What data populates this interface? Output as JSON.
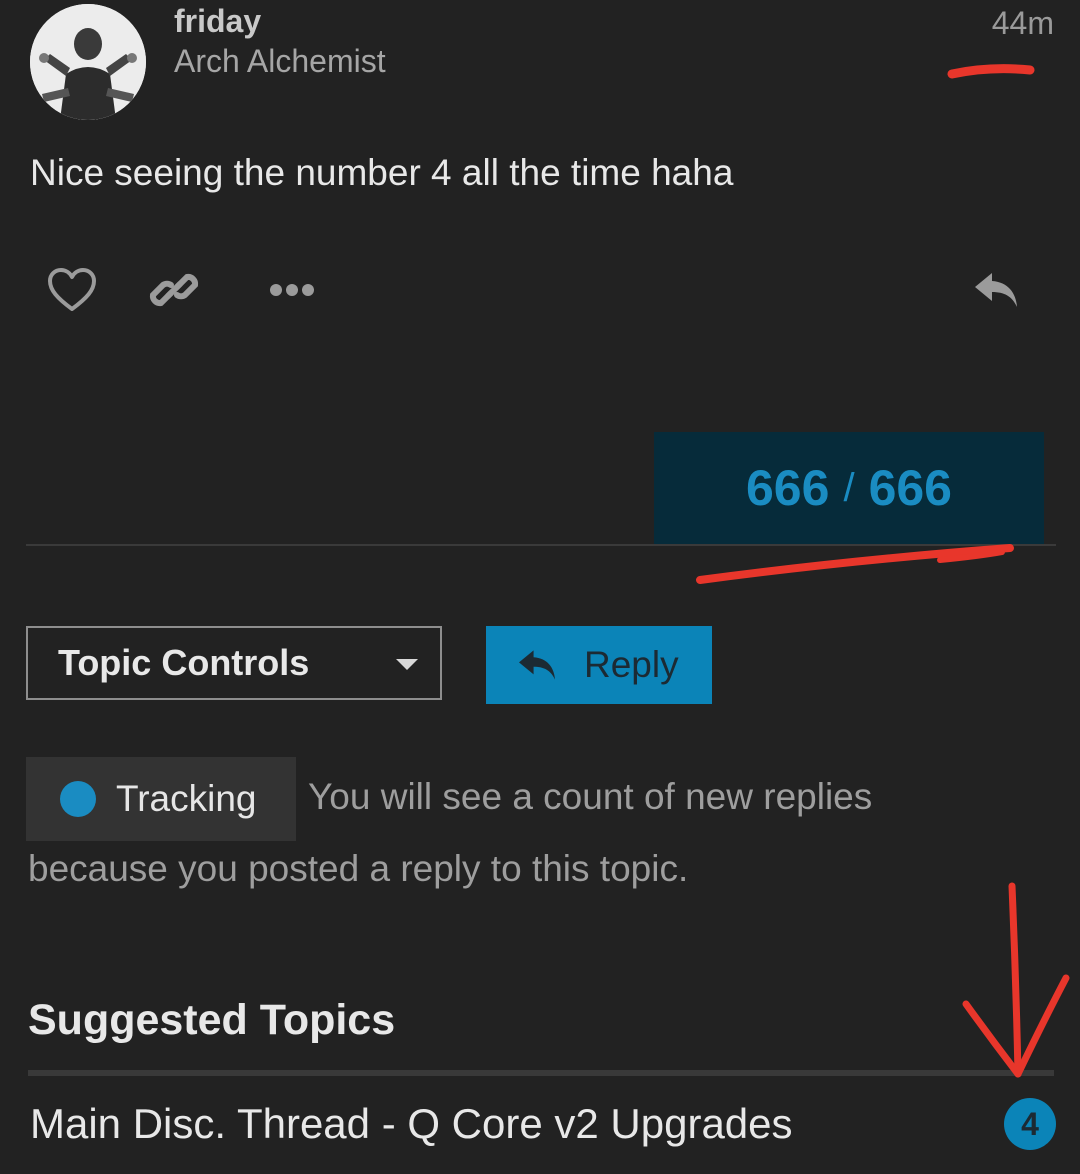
{
  "post": {
    "username": "friday",
    "user_title": "Arch Alchemist",
    "time": "44m",
    "body": "Nice seeing the number 4 all the time haha",
    "actions": {
      "like_icon": "heart-icon",
      "link_icon": "link-icon",
      "more_icon": "more-icon",
      "reply_icon": "reply-icon"
    }
  },
  "progress": {
    "current": "666",
    "separator": "/",
    "total": "666"
  },
  "controls": {
    "topic_controls_label": "Topic Controls",
    "reply_label": "Reply"
  },
  "tracking": {
    "label": "Tracking",
    "description_line1": "You will see a count of new replies",
    "description_line2": "because you posted a reply to this topic."
  },
  "suggested": {
    "heading": "Suggested Topics",
    "topics": [
      {
        "title": "Main Disc. Thread - Q Core v2 Upgrades",
        "new_count": "4"
      }
    ]
  },
  "colors": {
    "background": "#222222",
    "accent": "#0b84b8",
    "progress_bg": "#062b3a",
    "annotation": "#e8362b"
  }
}
